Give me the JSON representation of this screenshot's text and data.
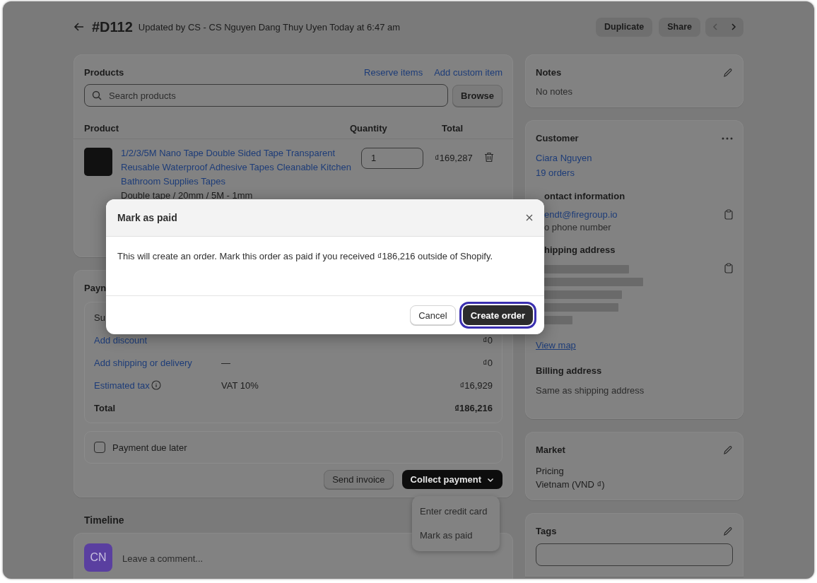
{
  "header": {
    "order_number": "#D112",
    "updated_text": "Updated by CS - CS Nguyen Dang Thuy Uyen Today at 6:47 am",
    "buttons": [
      "Duplicate",
      "Share"
    ],
    "prev_disabled": true
  },
  "products": {
    "title": "Products",
    "links": [
      "Reserve items",
      "Add custom item"
    ],
    "search": {
      "placeholder": "Search products"
    },
    "browse_button": "Browse",
    "columns": [
      "Product",
      "Quantity",
      "Total"
    ],
    "items": [
      {
        "name": "1/2/3/5M Nano Tape Double Sided Tape Transparent Reusable Waterproof Adhesive Tapes Cleanable Kitchen Bathroom Supplies Tapes",
        "variant": "Double tape / 20mm / 5M - 1mm",
        "quantity": "1",
        "total": "₫169,287"
      }
    ]
  },
  "payment": {
    "title": "Payn",
    "rows": [
      {
        "kind": "plain",
        "label": "Su"
      },
      {
        "kind": "link",
        "label": "Add discount",
        "amount": "₫0"
      },
      {
        "kind": "link",
        "label": "Add shipping or delivery",
        "detail": "—",
        "amount": "₫0"
      },
      {
        "kind": "link_info",
        "label": "Estimated tax",
        "detail": "VAT 10%",
        "amount": "₫16,929"
      },
      {
        "kind": "total",
        "label": "Total",
        "amount": "₫186,216"
      }
    ],
    "due_later": {
      "label": "Payment due later",
      "checked": false
    },
    "send_invoice": "Send invoice",
    "collect_payment": "Collect payment",
    "menu": [
      "Enter credit card",
      "Mark as paid"
    ]
  },
  "timeline": {
    "title": "Timeline",
    "avatar": "CN",
    "placeholder": "Leave a comment..."
  },
  "notes": {
    "title": "Notes",
    "text": "No notes"
  },
  "customer": {
    "title": "Customer",
    "name": "Ciara Nguyen",
    "orders": "19 orders",
    "contact_title": "ontact information",
    "email": "endt@firegroup.io",
    "phone": "o phone number",
    "shipping_title": "hipping address",
    "view_map": "View map",
    "billing_title": "Billing address",
    "billing_text": "Same as shipping address"
  },
  "market": {
    "title": "Market",
    "label": "Pricing",
    "value": "Vietnam (VND ₫)"
  },
  "tags": {
    "title": "Tags"
  },
  "modal": {
    "title": "Mark as paid",
    "message": "This will create an order. Mark this order as paid if you received ₫186,216 outside of Shopify.",
    "buttons": [
      {
        "label": "Cancel",
        "kind": "secondary",
        "focused": false
      },
      {
        "label": "Create order",
        "kind": "primary",
        "focused": true
      }
    ]
  }
}
